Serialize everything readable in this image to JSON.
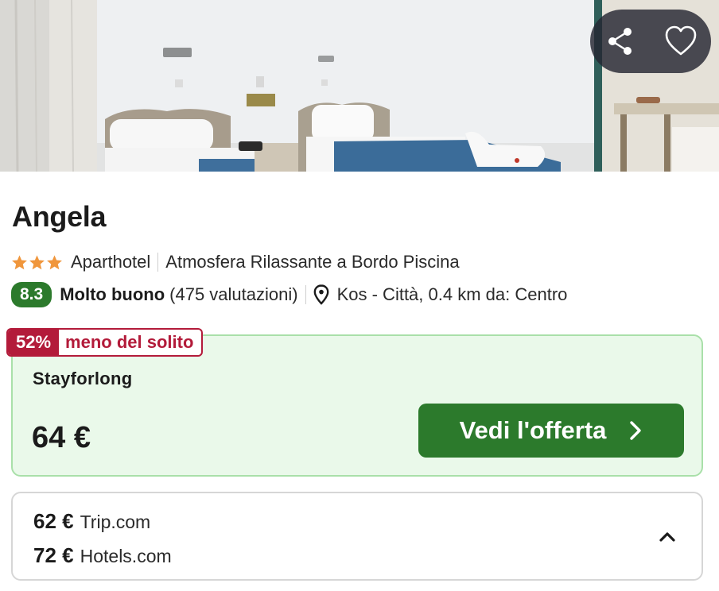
{
  "hotel": {
    "name": "Angela",
    "star_count": 3,
    "category": "Aparthotel",
    "tagline": "Atmosfera Rilassante a Bordo Piscina",
    "score": "8.3",
    "rating_word": "Molto buono",
    "reviews": "(475 valutazioni)",
    "location": "Kos - Città, 0.4 km da: Centro"
  },
  "icons": {
    "share": "share-icon",
    "favorite": "heart-icon",
    "star": "star-icon",
    "location": "map-pin-icon",
    "arrow": "chevron-right-icon",
    "collapse": "chevron-up-icon"
  },
  "deal": {
    "percent": "52%",
    "label": "meno del solito"
  },
  "best_offer": {
    "provider": "Stayforlong",
    "price": "64 €",
    "button": "Vedi l'offerta"
  },
  "other_offers": [
    {
      "price": "62 €",
      "provider": "Trip.com"
    },
    {
      "price": "72 €",
      "provider": "Hotels.com"
    }
  ],
  "colors": {
    "brand_green": "#2c7a2c",
    "offer_bg": "#eaf9ea",
    "deal_red": "#b31b3a",
    "star_orange": "#f0963c"
  }
}
